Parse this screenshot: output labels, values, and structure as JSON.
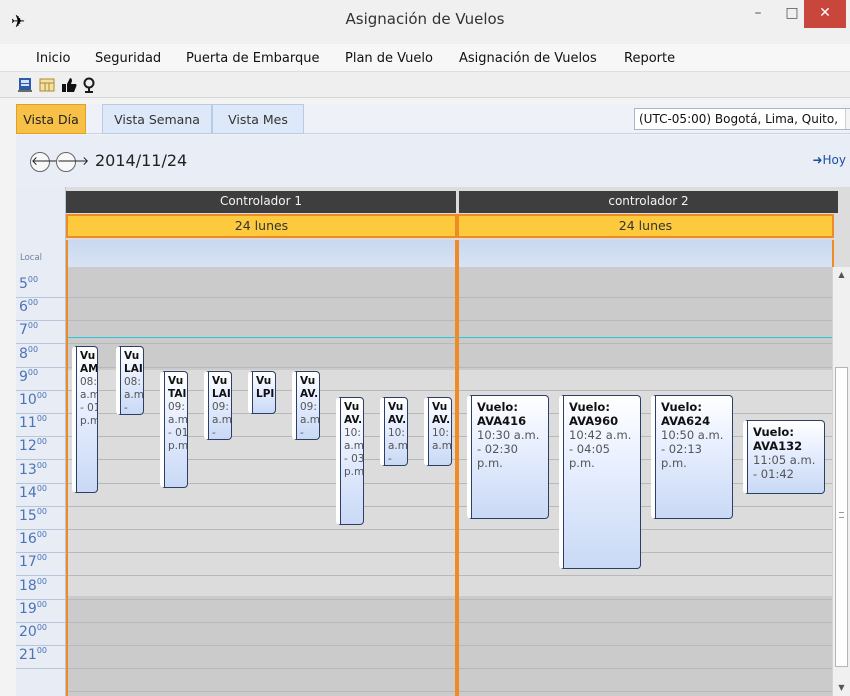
{
  "window": {
    "title": "Asignación de Vuelos",
    "minimize": "–",
    "maximize": "□",
    "close": "✕"
  },
  "menu": {
    "items": [
      "Inicio",
      "Seguridad",
      "Puerta de Embarque",
      "Plan de Vuelo",
      "Asignación de Vuelos",
      "Reporte"
    ]
  },
  "toolbar": {
    "icons": [
      "flight-board-icon",
      "calendar-grid-icon",
      "thumbs-up-icon",
      "location-pin-icon"
    ]
  },
  "views": {
    "tabs": [
      "Vista Día",
      "Vista Semana",
      "Vista Mes"
    ],
    "active": "Vista Día",
    "timezone": "(UTC-05:00) Bogotá, Lima, Quito,",
    "dropdown_arrow": "▼"
  },
  "navigation": {
    "date": "2014/11/24",
    "today": "➜Hoy",
    "prev": "🡐",
    "next": "🡒"
  },
  "scheduler": {
    "local_label": "Local",
    "hours": [
      "5",
      "6",
      "7",
      "8",
      "9",
      "10",
      "11",
      "12",
      "13",
      "14",
      "15",
      "16",
      "17",
      "18",
      "19",
      "20",
      "21"
    ],
    "minutes_suffix": "00",
    "resources": [
      {
        "name": "Controlador 1",
        "day": "24 lunes",
        "flights": [
          {
            "line1": "Vu",
            "line2": "AM",
            "line3": "08:",
            "line4": "a.m",
            "line5": "- 01:",
            "line6": "p.m"
          },
          {
            "line1": "Vu",
            "line2": "LAI",
            "line3": "08:",
            "line4": "a.m",
            "line5": "-"
          },
          {
            "line1": "Vu",
            "line2": "TAI",
            "line3": "09:",
            "line4": "a.m",
            "line5": "- 01:",
            "line6": "p.m"
          },
          {
            "line1": "Vu",
            "line2": "LAI",
            "line3": "09:",
            "line4": "a.m",
            "line5": "-"
          },
          {
            "line1": "Vu",
            "line2": "LPI"
          },
          {
            "line1": "Vu",
            "line2": "AV.",
            "line3": "09:",
            "line4": "a.m",
            "line5": "-"
          },
          {
            "line1": "Vu",
            "line2": "AV.",
            "line3": "10:",
            "line4": "a.m",
            "line5": "- 03:",
            "line6": "p.m"
          },
          {
            "line1": "Vu",
            "line2": "AV.",
            "line3": "10:",
            "line4": "a.m",
            "line5": "-"
          },
          {
            "line1": "Vu",
            "line2": "AV.",
            "line3": "10:",
            "line4": "a.m"
          }
        ]
      },
      {
        "name": "controlador 2",
        "day": "24 lunes",
        "flights": [
          {
            "line1": "Vuelo:",
            "line2": "AVA416",
            "line3": "10:30 a.m.",
            "line4": "- 02:30",
            "line5": "p.m."
          },
          {
            "line1": "Vuelo:",
            "line2": "AVA960",
            "line3": "10:42 a.m.",
            "line4": "- 04:05",
            "line5": "p.m."
          },
          {
            "line1": "Vuelo:",
            "line2": "AVA624",
            "line3": "10:50 a.m.",
            "line4": "- 02:13",
            "line5": "p.m."
          },
          {
            "line1": "Vuelo:",
            "line2": "AVA132",
            "line3": "11:05 a.m.",
            "line4": "- 01:42"
          }
        ]
      }
    ]
  },
  "colors": {
    "accent_orange": "#f08a24",
    "day_header": "#fcca3c",
    "active_tab": "#f6c146",
    "close_button": "#c8463b",
    "now_line": "#2fc5d8",
    "hour_text": "#4b73b8"
  }
}
